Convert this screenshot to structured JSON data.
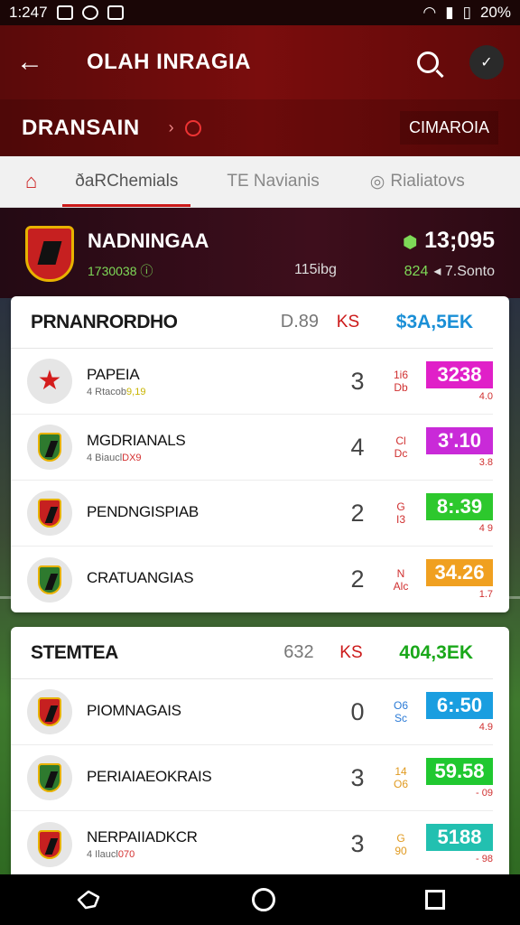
{
  "status": {
    "time": "1:247",
    "battery": "20%"
  },
  "appbar": {
    "title": "OLAH INRAGIA",
    "league": "DRANSAIN",
    "league_right": "CIMAROIA"
  },
  "tabs": [
    {
      "label": "ðaRChemials"
    },
    {
      "label": "TE Navianis"
    },
    {
      "label": "Rialiatovs"
    }
  ],
  "match": {
    "name": "NADNINGAA",
    "code": "1730038",
    "mid": "115ibg",
    "score": "13;095",
    "sub_green": "824",
    "sub": "7.Sonto"
  },
  "groups": [
    {
      "title": "PRNANRORDHO",
      "num": "D.89",
      "ks": "KS",
      "total": "$3A,5EK",
      "total_color": "#1a8fd6",
      "rows": [
        {
          "name": "PAPEIA",
          "sub_a": "4 Rtacob",
          "sub_b": "9,19",
          "pts": "3",
          "mini1": "1i6",
          "mini2": "Db",
          "mini_class": "",
          "badge": "3238",
          "badge_color": "#e020c8",
          "badge_sub": "4.0",
          "icon": "star-icon"
        },
        {
          "name": "MGDRIANALS",
          "sub_a": "4 Biaucl",
          "sub_b": "DX9",
          "pts": "4",
          "mini1": "Cl",
          "mini2": "Dc",
          "mini_class": "",
          "badge": "3'.10",
          "badge_color": "#c92ad8",
          "badge_sub": "3.8",
          "icon": "shield-icon"
        },
        {
          "name": "PENDNGISPIAB",
          "sub_a": "",
          "sub_b": "",
          "pts": "2",
          "mini1": "G",
          "mini2": "I3",
          "mini_class": "",
          "badge": "8:.39",
          "badge_color": "#2dc82d",
          "badge_sub": "4 9",
          "icon": "shield-icon"
        },
        {
          "name": "CRATUANGIAS",
          "sub_a": "",
          "sub_b": "",
          "pts": "2",
          "mini1": "N",
          "mini2": "Alc",
          "mini_class": "",
          "badge": "34.26",
          "badge_color": "#f0a020",
          "badge_sub": "1.7",
          "icon": "shield-icon"
        }
      ]
    },
    {
      "title": "STEMTEA",
      "num": "632",
      "ks": "KS",
      "total": "404,3EK",
      "total_color": "#1aa81a",
      "rows": [
        {
          "name": "PIOMNAGAIS",
          "sub_a": "",
          "sub_b": "",
          "pts": "0",
          "mini1": "O6",
          "mini2": "Sc",
          "mini_class": "blue",
          "badge": "6:.50",
          "badge_color": "#1a9ee0",
          "badge_sub": "4.9",
          "icon": "shield-icon"
        },
        {
          "name": "PERIAIAEOKRAIS",
          "sub_a": "",
          "sub_b": "",
          "pts": "3",
          "mini1": "14",
          "mini2": "O6",
          "mini_class": "org",
          "badge": "59.58",
          "badge_color": "#20c830",
          "badge_sub": "- 09",
          "icon": "shield-icon"
        },
        {
          "name": "NERPAIIADKCR",
          "sub_a": "4 Ilaucl",
          "sub_b": "070",
          "pts": "3",
          "mini1": "G",
          "mini2": "90",
          "mini_class": "org",
          "badge": "5188",
          "badge_color": "#22c0b0",
          "badge_sub": "- 98",
          "icon": "shield-icon"
        }
      ]
    }
  ]
}
